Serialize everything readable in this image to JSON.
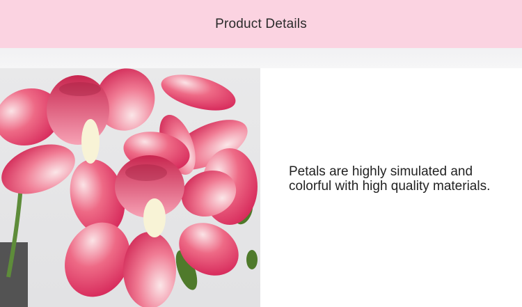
{
  "header": {
    "title": "Product Details",
    "background_color": "#fbd3e1"
  },
  "product_image": {
    "subject": "pink and white orchid flowers"
  },
  "description": {
    "text": "Petals are highly simulated and colorful with high quality materials."
  }
}
